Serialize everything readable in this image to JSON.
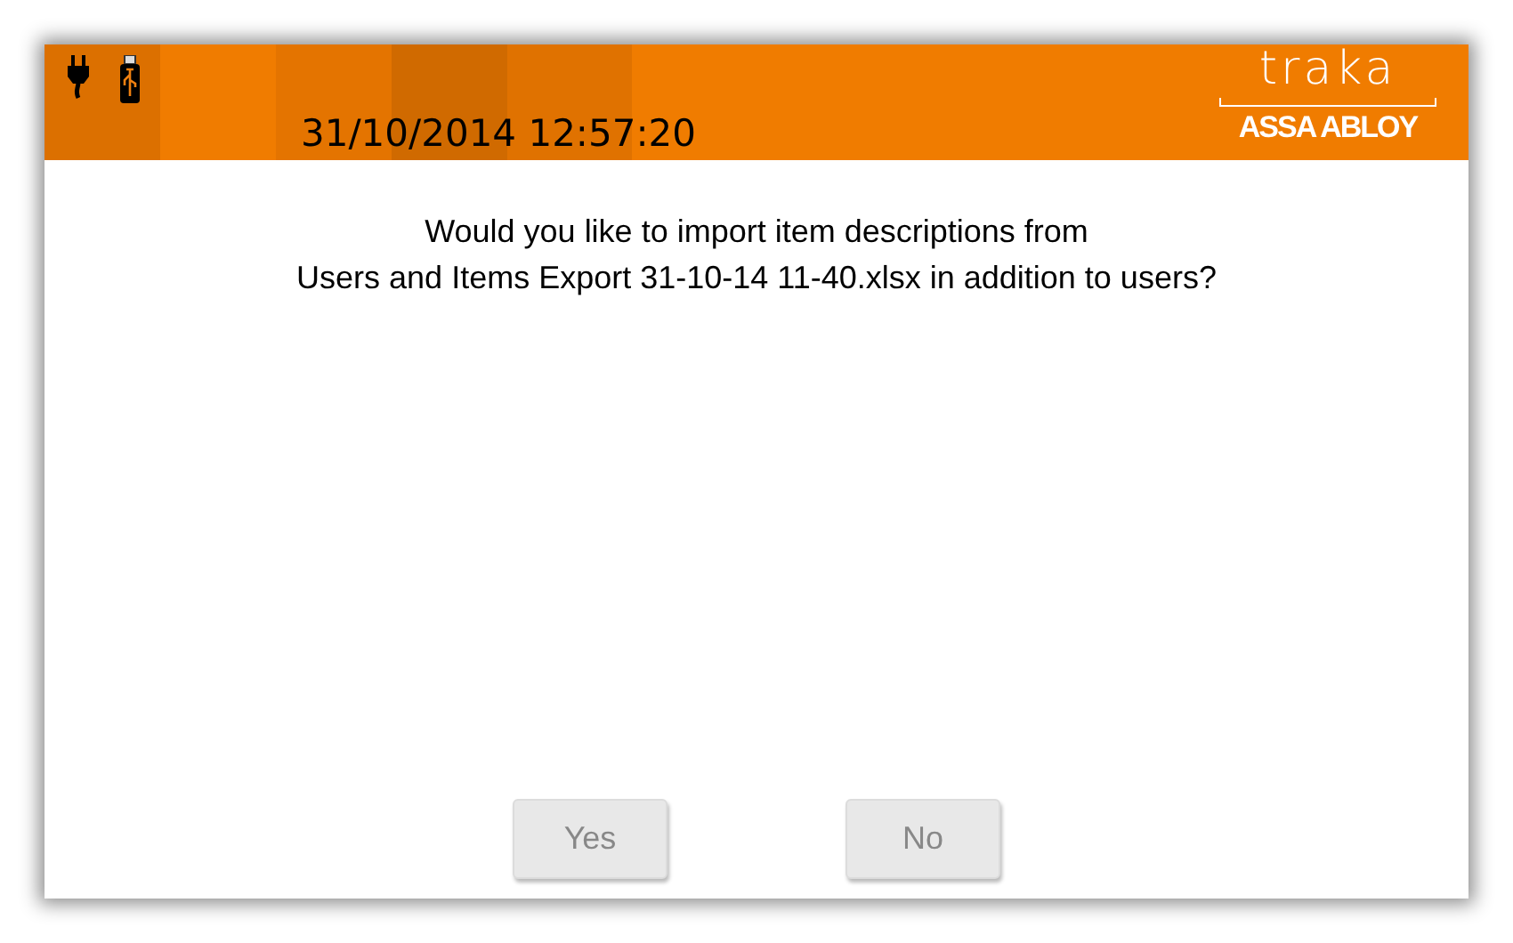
{
  "header": {
    "datetime": "31/10/2014 12:57:20",
    "logo": {
      "brand": "traka",
      "parent": "ASSA ABLOY"
    }
  },
  "dialog": {
    "message_lines": [
      "Would you like to import item descriptions from",
      "Users and Items Export 31-10-14 11-40.xlsx in addition to users?"
    ]
  },
  "buttons": [
    {
      "label": "Yes"
    },
    {
      "label": "No"
    }
  ]
}
